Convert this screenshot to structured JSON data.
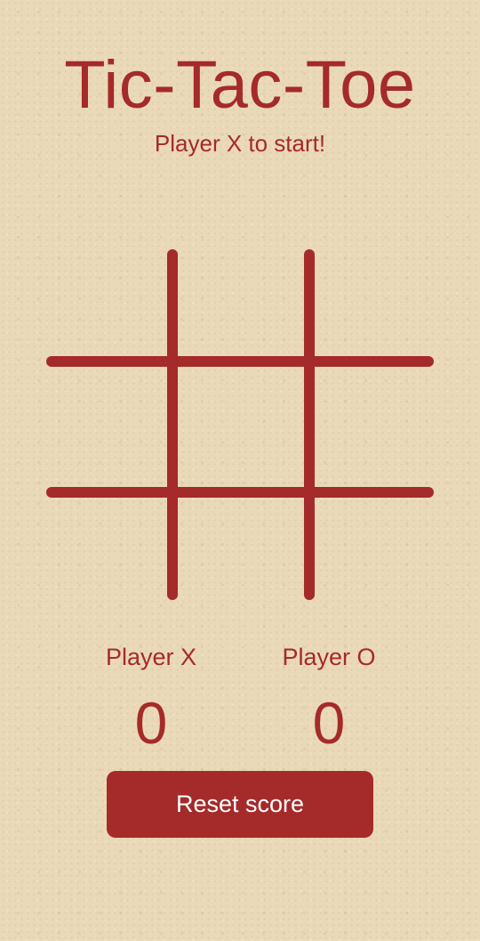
{
  "app": {
    "title": "Tic-Tac-Toe",
    "status": "Player X to start!"
  },
  "board": {
    "cells": [
      "",
      "",
      "",
      "",
      "",
      "",
      "",
      "",
      ""
    ],
    "line_color": "#a52a2a"
  },
  "scoreboard": {
    "player_x": {
      "label": "Player X",
      "score": "0"
    },
    "player_o": {
      "label": "Player O",
      "score": "0"
    }
  },
  "controls": {
    "reset_label": "Reset score"
  },
  "colors": {
    "accent": "#a52a2a",
    "background": "#ead9b8",
    "button_text": "#ffffff"
  }
}
